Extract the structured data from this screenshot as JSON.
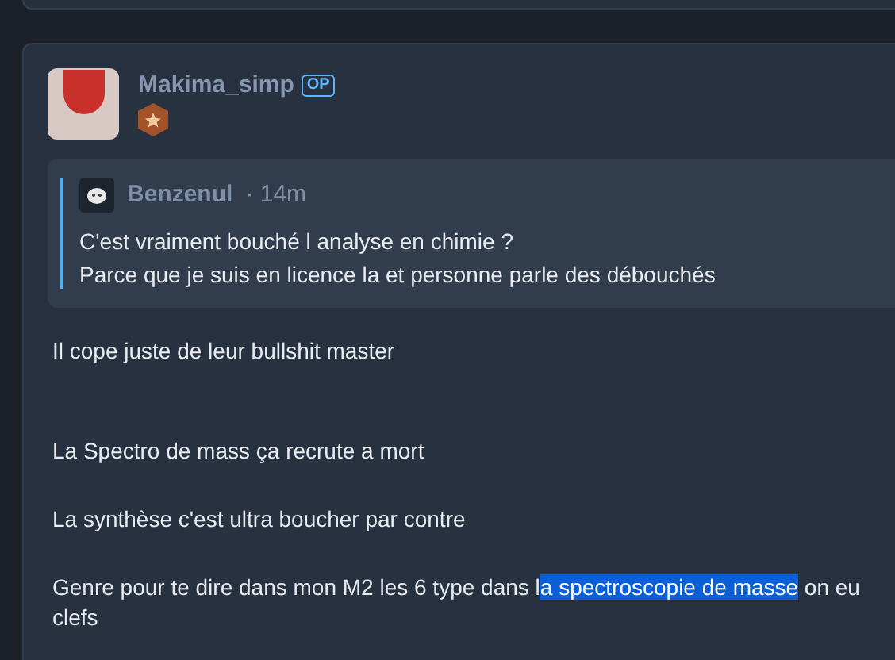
{
  "post": {
    "author": "Makima_simp",
    "author_badge": "OP",
    "quote": {
      "author": "Benzenul",
      "separator": "·",
      "time": "14m",
      "lines": [
        "C'est vraiment bouché l analyse en chimie ?",
        "Parce que je suis en licence la et personne parle des débouchés"
      ]
    },
    "paragraphs": [
      {
        "parts": [
          {
            "text": "Il cope juste de leur bullshit master",
            "highlighted": false
          }
        ]
      },
      {
        "parts": [
          {
            "text": "La Spectro de mass ça recrute a mort",
            "highlighted": false
          }
        ]
      },
      {
        "parts": [
          {
            "text": "La synthèse c'est ultra boucher par contre",
            "highlighted": false
          }
        ]
      },
      {
        "parts": [
          {
            "text": "Genre pour te dire dans mon M2 les 6 type dans l",
            "highlighted": false
          },
          {
            "text": "a spectroscopie de masse",
            "highlighted": true
          },
          {
            "text": " on eu clefs",
            "highlighted": false
          }
        ]
      }
    ]
  }
}
